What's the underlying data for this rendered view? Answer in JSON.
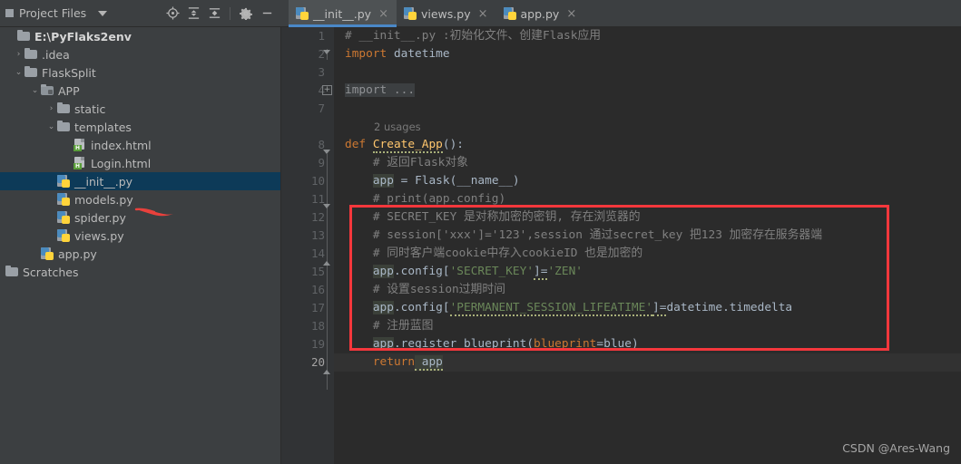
{
  "project_panel": {
    "title": "Project Files",
    "icons": [
      "target-locate-icon",
      "expand-all-icon",
      "collapse-all-icon",
      "settings-gear-icon",
      "minimize-icon"
    ],
    "tree": [
      {
        "label": "E:\\PyFlaks2env",
        "type": "root-folder",
        "indent": 0,
        "arrow": "",
        "bold": true,
        "selected": false
      },
      {
        "label": ".idea",
        "type": "folder",
        "indent": 1,
        "arrow": "›",
        "bold": false,
        "selected": false
      },
      {
        "label": "FlaskSplit",
        "type": "folder",
        "indent": 1,
        "arrow": "⌄",
        "bold": false,
        "selected": false
      },
      {
        "label": "APP",
        "type": "module-folder",
        "indent": 2,
        "arrow": "⌄",
        "bold": false,
        "selected": false
      },
      {
        "label": "static",
        "type": "folder",
        "indent": 3,
        "arrow": "›",
        "bold": false,
        "selected": false
      },
      {
        "label": "templates",
        "type": "folder",
        "indent": 3,
        "arrow": "⌄",
        "bold": false,
        "selected": false
      },
      {
        "label": "index.html",
        "type": "html",
        "indent": 4,
        "arrow": "",
        "bold": false,
        "selected": false
      },
      {
        "label": "Login.html",
        "type": "html",
        "indent": 4,
        "arrow": "",
        "bold": false,
        "selected": false
      },
      {
        "label": "__init__.py",
        "type": "python",
        "indent": 3,
        "arrow": "",
        "bold": false,
        "selected": true
      },
      {
        "label": "models.py",
        "type": "python",
        "indent": 3,
        "arrow": "",
        "bold": false,
        "selected": false
      },
      {
        "label": "spider.py",
        "type": "python",
        "indent": 3,
        "arrow": "",
        "bold": false,
        "selected": false
      },
      {
        "label": "views.py",
        "type": "python",
        "indent": 3,
        "arrow": "",
        "bold": false,
        "selected": false
      },
      {
        "label": "app.py",
        "type": "python",
        "indent": 2,
        "arrow": "",
        "bold": false,
        "selected": false
      },
      {
        "label": "Scratches",
        "type": "folder",
        "indent": 0,
        "arrow": "",
        "bold": false,
        "selected": false
      }
    ]
  },
  "tabs": [
    {
      "label": "__init__.py",
      "icon": "python-file-icon",
      "active": true,
      "close": "×"
    },
    {
      "label": "views.py",
      "icon": "python-file-icon",
      "active": false,
      "close": "×"
    },
    {
      "label": "app.py",
      "icon": "python-file-icon",
      "active": false,
      "close": "×"
    }
  ],
  "editor": {
    "usages_hint": "2 usages",
    "line_numbers": [
      "1",
      "2",
      "3",
      "4",
      "7",
      "",
      "8",
      "9",
      "10",
      "11",
      "12",
      "13",
      "14",
      "15",
      "16",
      "17",
      "18",
      "19",
      "20"
    ],
    "current_line": "20",
    "lines": {
      "l1_comment": "# __init__.py :初始化文件、创建Flask应用",
      "l2_kw": "import",
      "l2_mod": " datetime",
      "l4_fold": "import ...",
      "l8_kw": "def",
      "l8_fn": "Create_App",
      "l8_tail": "():",
      "l9_comment": "# 返回Flask对象",
      "l10_var": "app",
      "l10_rest": " = Flask(__name__)",
      "l11_comment": "# print(app.config)",
      "l12_comment": "# SECRET_KEY 是对称加密的密钥, 存在浏览器的",
      "l13_comment": "# session['xxx']='123',session 通过secret_key 把123 加密存在服务器端",
      "l14_comment": "# 同时客户端cookie中存入cookieID 也是加密的",
      "l15_var": "app",
      "l15_mid": ".config[",
      "l15_key": "'SECRET_KEY'",
      "l15_eq": "]=",
      "l15_val": "'ZEN'",
      "l16_comment": "# 设置session过期时间",
      "l17_var": "app",
      "l17_mid": ".config[",
      "l17_key": "'PERMANENT_SESSION_LIFEATIME'",
      "l17_eq": "]=",
      "l17_val": "datetime.timedelta",
      "l18_comment": "# 注册蓝图",
      "l19_var": "app",
      "l19_mid": ".register_blueprint(",
      "l19_param": "blueprint",
      "l19_eq": "=",
      "l19_arg": "blue",
      "l19_close": ")",
      "l20_kw": "return",
      "l20_var": " app"
    },
    "annotation": {
      "highlight_color": "#f5373c",
      "arrow_color": "#e8413c"
    }
  },
  "watermark": "CSDN @Ares-Wang",
  "colors": {
    "background": "#2b2b2b",
    "panel": "#3c3f41",
    "selection": "#0d3a58",
    "accent": "#4a88c7",
    "keyword": "#cc7832",
    "string": "#6a8759",
    "comment": "#808080",
    "function": "#ffc66d"
  }
}
